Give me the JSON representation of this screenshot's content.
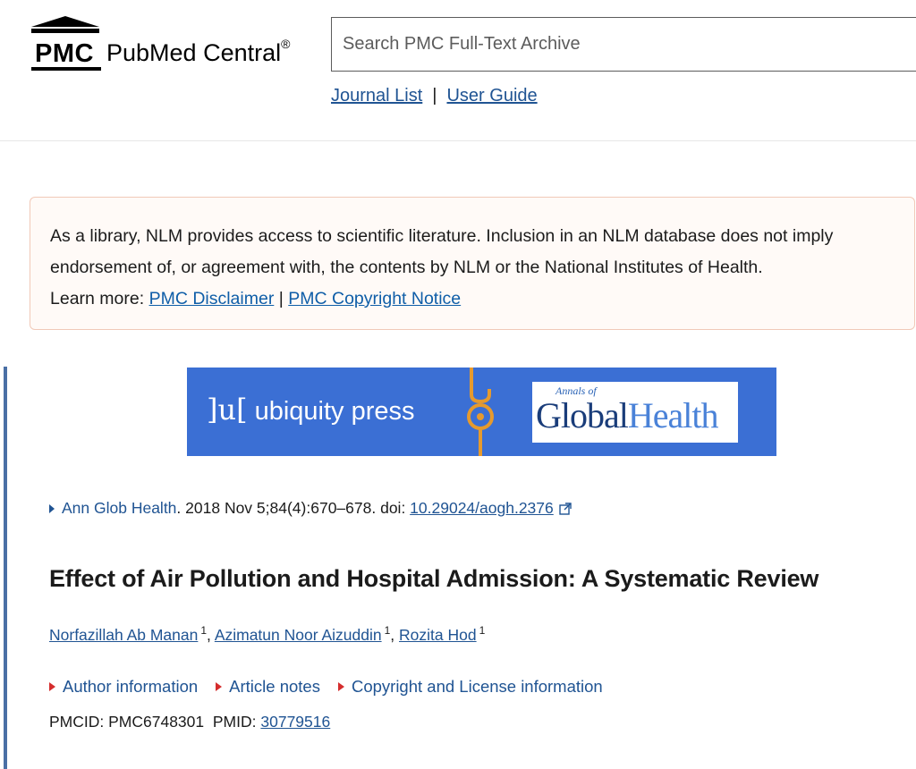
{
  "header": {
    "logo_abbr": "PMC",
    "logo_name": "PubMed Central",
    "logo_mark": "®",
    "search_placeholder": "Search PMC Full-Text Archive",
    "links": {
      "journal_list": "Journal List",
      "separator": "|",
      "user_guide": "User Guide"
    }
  },
  "disclaimer": {
    "text": "As a library, NLM provides access to scientific literature. Inclusion in an NLM database does not imply endorsement of, or agreement with, the contents by NLM or the National Institutes of Health.",
    "learn_more": "Learn more:",
    "link1": "PMC Disclaimer",
    "separator": "|",
    "link2": "PMC Copyright Notice"
  },
  "banner": {
    "brand_mark": "]u[",
    "brand_text": "ubiquity press",
    "journal_small": "Annals of",
    "journal_word1": "Global",
    "journal_word2": "Health",
    "colors": {
      "background": "#3b6fd4",
      "lock": "#e69a2e"
    }
  },
  "article": {
    "journal_link": "Ann Glob Health",
    "citation_rest": ". 2018 Nov 5;84(4):670–678. doi: ",
    "doi": "10.29024/aogh.2376",
    "title": "Effect of Air Pollution and Hospital Admission: A Systematic Review",
    "authors": [
      {
        "name": "Norfazillah Ab Manan",
        "aff": "1"
      },
      {
        "name": "Azimatun Noor Aizuddin",
        "aff": "1"
      },
      {
        "name": "Rozita Hod",
        "aff": "1"
      }
    ],
    "expanders": [
      "Author information",
      "Article notes",
      "Copyright and License information"
    ],
    "pmcid_label": "PMCID: PMC6748301",
    "pmid_label": "PMID:",
    "pmid": "30779516"
  }
}
